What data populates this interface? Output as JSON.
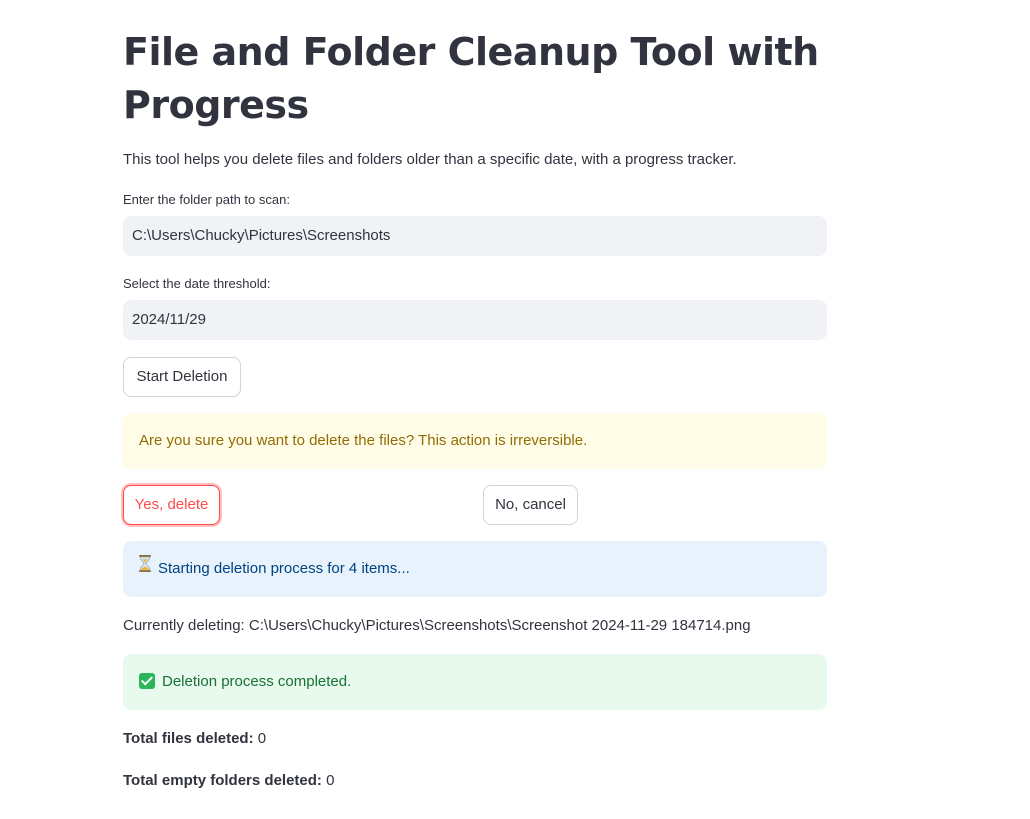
{
  "header": {
    "title": "File and Folder Cleanup Tool with Progress",
    "description": "This tool helps you delete files and folders older than a specific date, with a progress tracker."
  },
  "folder_path": {
    "label": "Enter the folder path to scan:",
    "value": "C:\\Users\\Chucky\\Pictures\\Screenshots"
  },
  "date_threshold": {
    "label": "Select the date threshold:",
    "value": "2024/11/29"
  },
  "actions": {
    "start_label": "Start Deletion",
    "confirm_label": "Yes, delete",
    "cancel_label": "No, cancel"
  },
  "alerts": {
    "warning": "Are you sure you want to delete the files? This action is irreversible.",
    "info_icon": "hourglass-icon",
    "info": "Starting deletion process for 4 items...",
    "success_icon": "check-icon",
    "success": "Deletion process completed."
  },
  "progress": {
    "current_label": "Currently deleting: C:\\Users\\Chucky\\Pictures\\Screenshots\\Screenshot 2024-11-29 184714.png"
  },
  "stats": {
    "files_label": "Total files deleted:",
    "files_value": "0",
    "folders_label": "Total empty folders deleted:",
    "folders_value": "0"
  },
  "colors": {
    "text": "#31333f",
    "danger": "#ff4b4b",
    "warning_bg": "#fffce7",
    "warning_text": "#926c05",
    "info_bg": "#e8f2fc",
    "info_text": "#004280",
    "success_bg": "#e8f9ee",
    "success_text": "#177233",
    "input_bg": "#f0f2f6"
  }
}
